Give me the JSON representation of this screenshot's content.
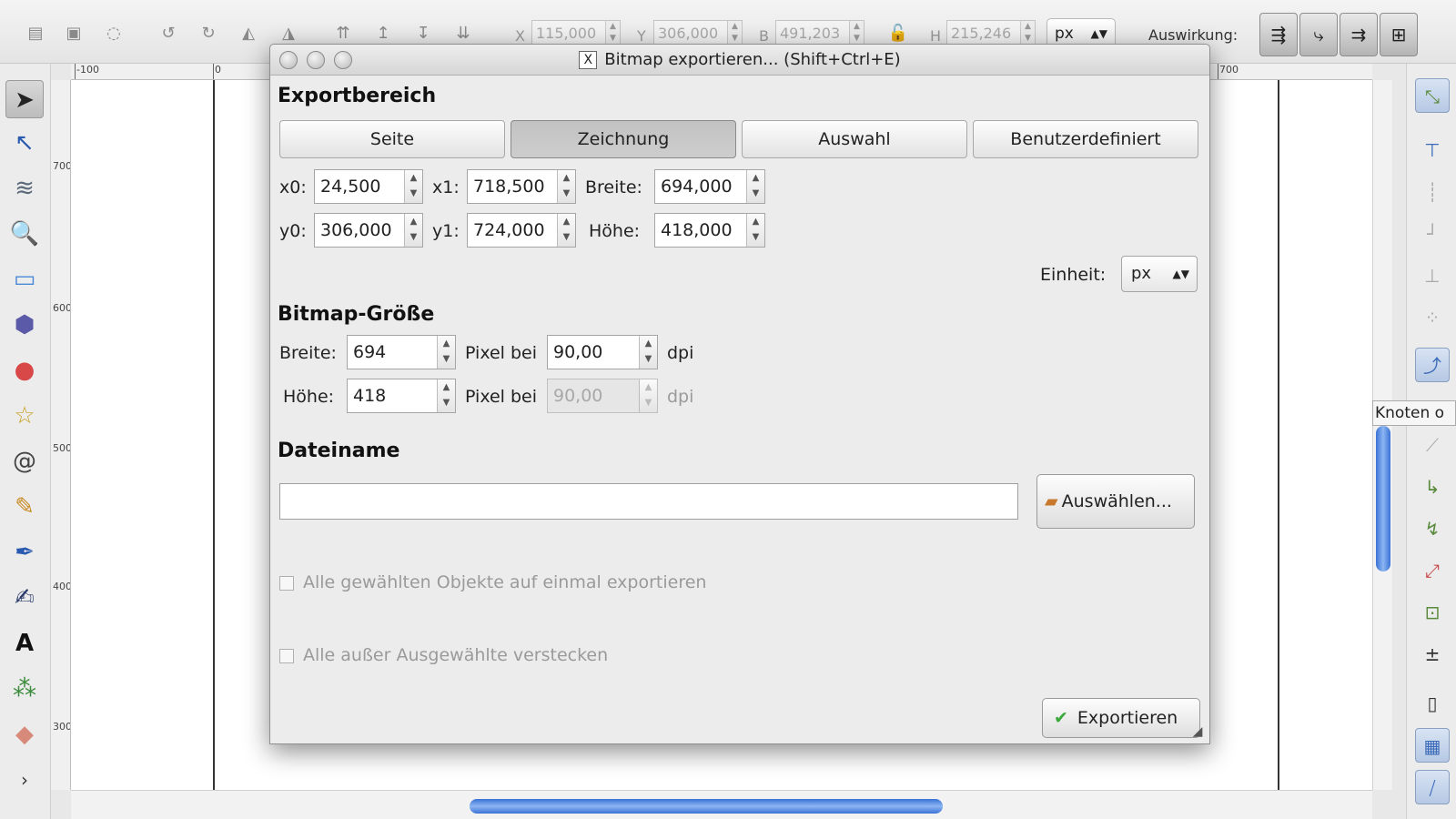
{
  "toolbar": {
    "x_label": "X",
    "x_value": "115,000",
    "y_label": "Y",
    "y_value": "306,000",
    "b_label": "B",
    "b_value": "491,203",
    "h_label": "H",
    "h_value": "215,246",
    "unit": "px",
    "auswirkung_label": "Auswirkung:"
  },
  "rulers": {
    "h_marks": [
      "-100",
      "0",
      "700"
    ],
    "v_marks": [
      "700",
      "600",
      "500",
      "400",
      "300"
    ]
  },
  "dialog": {
    "title": "Bitmap exportieren... (Shift+Ctrl+E)",
    "export_area": {
      "heading": "Exportbereich",
      "tabs": [
        {
          "label": "Seite",
          "selected": false
        },
        {
          "label": "Zeichnung",
          "selected": true
        },
        {
          "label": "Auswahl",
          "selected": false
        },
        {
          "label": "Benutzerdefiniert",
          "selected": false
        }
      ],
      "x0_label": "x0:",
      "x0_value": "24,500",
      "x1_label": "x1:",
      "x1_value": "718,500",
      "width_label": "Breite:",
      "width_value": "694,000",
      "y0_label": "y0:",
      "y0_value": "306,000",
      "y1_label": "y1:",
      "y1_value": "724,000",
      "height_label": "Höhe:",
      "height_value": "418,000",
      "unit_label": "Einheit:",
      "unit_value": "px"
    },
    "bitmap_size": {
      "heading": "Bitmap-Größe",
      "width_label": "Breite:",
      "width_value": "694",
      "height_label": "Höhe:",
      "height_value": "418",
      "pixel_bei": "Pixel bei",
      "dpi_x_value": "90,00",
      "dpi_y_value": "90,00",
      "dpi_unit": "dpi"
    },
    "filename": {
      "heading": "Dateiname",
      "value": "",
      "browse_label": "Auswählen..."
    },
    "options": {
      "batch_export": "Alle gewählten Objekte auf einmal exportieren",
      "hide_unselected": "Alle außer Ausgewählte verstecken"
    },
    "export_button": "Exportieren"
  },
  "tooltip": "Knoten o"
}
